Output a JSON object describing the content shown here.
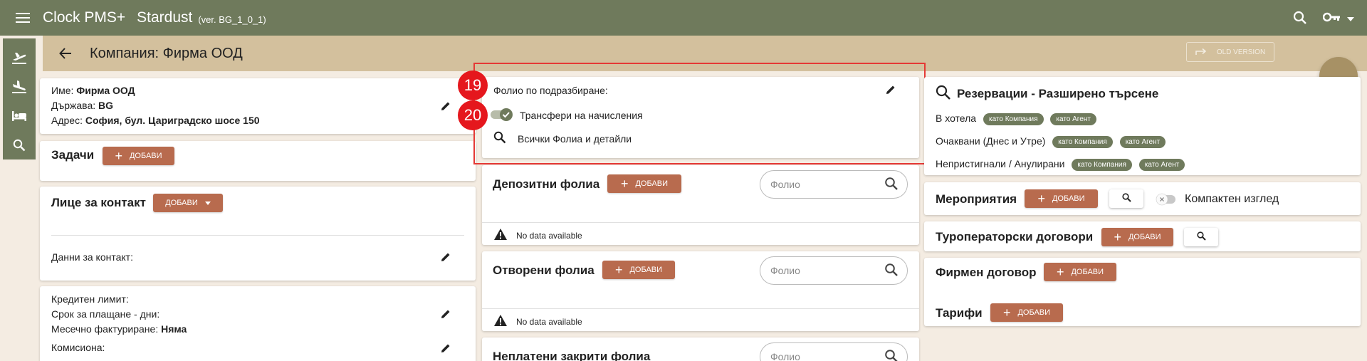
{
  "header": {
    "app_title": "Clock PMS+",
    "property": "Stardust",
    "version": "(ver. BG_1_0_1)"
  },
  "subheader": {
    "title": "Компания: Фирма ООД",
    "old_version_label": "OLD VERSION"
  },
  "company": {
    "name_label": "Име:",
    "name_value": "Фирма ООД",
    "country_label": "Държава:",
    "country_value": "BG",
    "address_label": "Адрес:",
    "address_value": "София, бул. Цариградско шосе 150"
  },
  "tasks": {
    "title": "Задачи",
    "add_label": "ДОБАВИ"
  },
  "contacts": {
    "title": "Лице за контакт",
    "add_label": "ДОБАВИ",
    "contact_data_label": "Данни за контакт:"
  },
  "financial": {
    "credit_limit_label": "Кредитен лимит:",
    "payment_term_label": "Срок за плащане - дни:",
    "monthly_invoice_label": "Месечно фактуриране:",
    "monthly_invoice_value": "Няма",
    "commission_label": "Комисиона:"
  },
  "folio_default": {
    "label": "Фолио по подразбиране:",
    "transfer_label": "Трансфери на начисления",
    "all_folios_label": "Всички Фолиа и детайли",
    "badge_19": "19",
    "badge_20": "20"
  },
  "deposit_folios": {
    "title": "Депозитни фолиа",
    "add_label": "ДОБАВИ",
    "search_placeholder": "Фолио",
    "no_data": "No data available"
  },
  "open_folios": {
    "title": "Отворени фолиа",
    "add_label": "ДОБАВИ",
    "search_placeholder": "Фолио",
    "no_data": "No data available"
  },
  "unpaid_folios": {
    "title": "Неплатени закрити фолиа",
    "search_placeholder": "Фолио"
  },
  "reservations": {
    "title": "Резервации - Разширено търсене",
    "in_hotel_label": "В хотела",
    "expected_label": "Очаквани (Днес и Утре)",
    "noshow_label": "Непристигнали / Анулирани",
    "as_company": "като Компания",
    "as_agent": "като Агент"
  },
  "events": {
    "title": "Мероприятия",
    "add_label": "ДОБАВИ",
    "compact_label": "Компактен изглед"
  },
  "tour_contracts": {
    "title": "Туроператорски договори",
    "add_label": "ДОБАВИ"
  },
  "company_contract": {
    "title": "Фирмен договор",
    "add_label": "ДОБАВИ"
  },
  "tariffs": {
    "title": "Тарифи",
    "add_label": "ДОБАВИ"
  },
  "colors": {
    "topbar": "#6f7a5c",
    "subbar": "#d3c09d",
    "accent_button": "#b86b4e",
    "chip": "#6f7a5c",
    "highlight": "#e53935"
  },
  "icons": {
    "menu": "menu-icon",
    "search": "search-icon",
    "key": "key-icon",
    "arrival": "flight-land-icon",
    "departure": "flight-takeoff-icon",
    "rooms": "bed-icon",
    "back": "arrow-back-icon",
    "edit": "pencil-icon",
    "more": "more-horizontal-icon",
    "warning": "warning-icon"
  }
}
